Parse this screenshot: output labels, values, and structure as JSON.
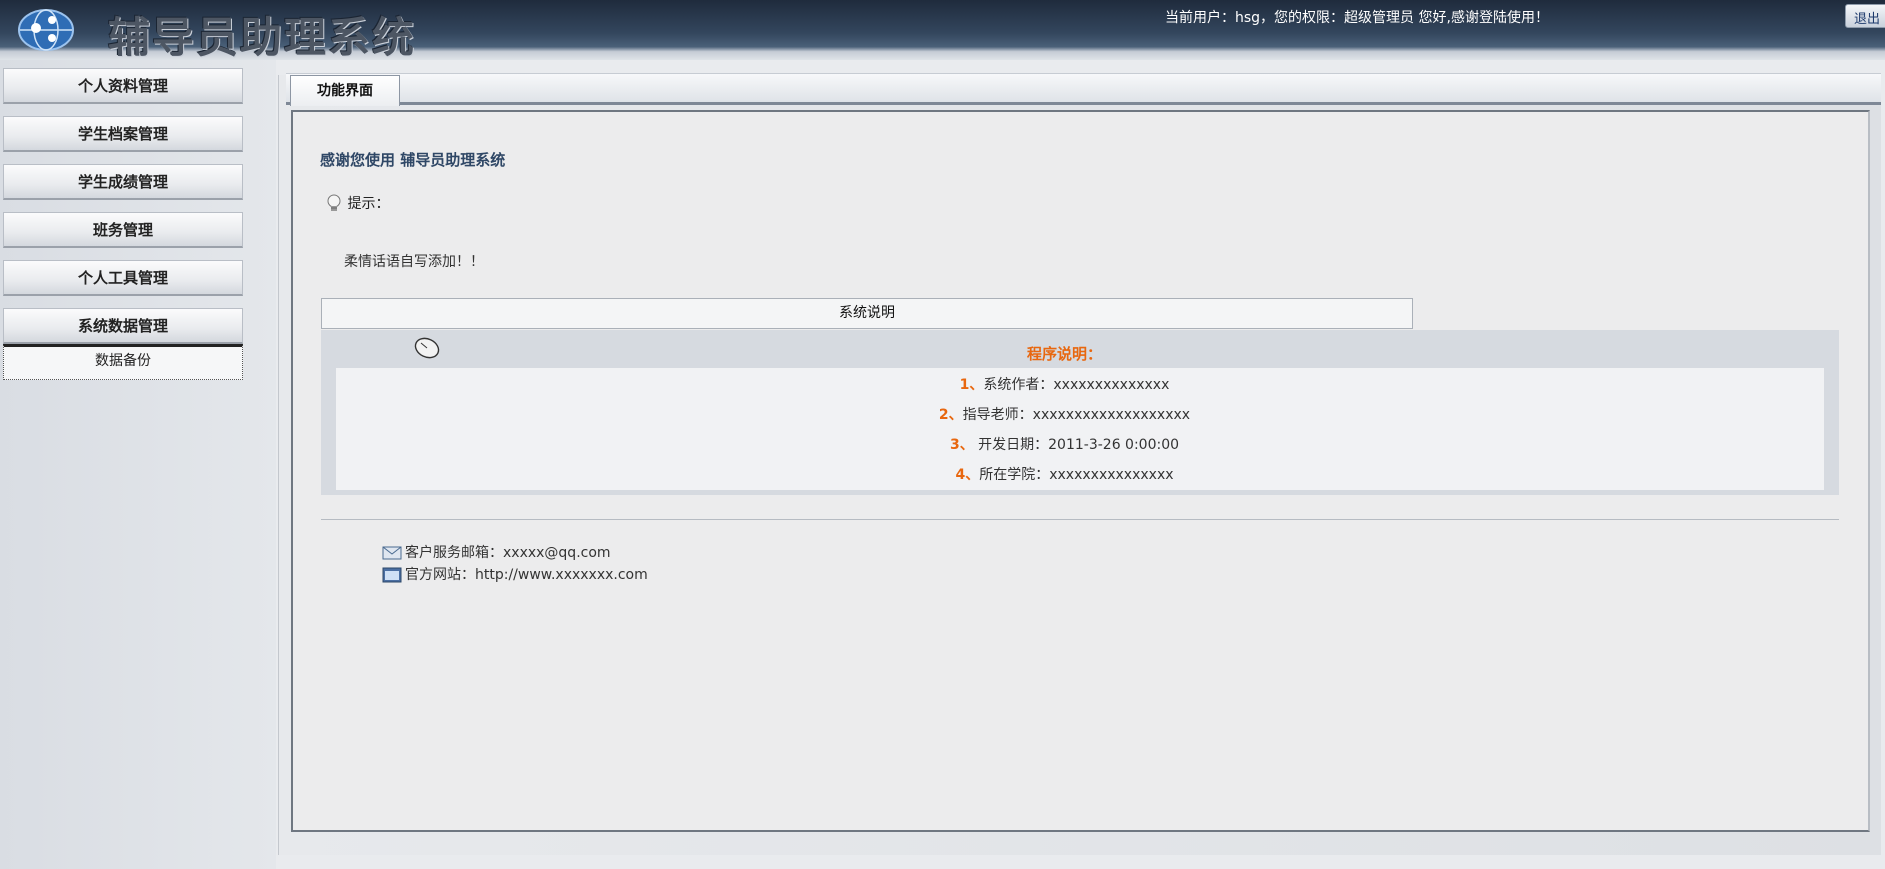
{
  "header": {
    "app_title": "辅导员助理系统",
    "user_info": "当前用户：hsg，您的权限：超级管理员 您好,感谢登陆使用！",
    "logout_label": "退出"
  },
  "sidebar": {
    "items": [
      {
        "label": "个人资料管理"
      },
      {
        "label": "学生档案管理"
      },
      {
        "label": "学生成绩管理"
      },
      {
        "label": "班务管理"
      },
      {
        "label": "个人工具管理"
      },
      {
        "label": "系统数据管理"
      }
    ],
    "submenu_item": "数据备份"
  },
  "main": {
    "tab_label": "功能界面",
    "welcome": "感谢您使用 辅导员助理系统",
    "tip_label": "提示：",
    "message": "柔情话语自写添加！！",
    "system_desc_label": "系统说明",
    "program_title": "程序说明：",
    "info_lines": [
      {
        "num": "1、",
        "text": "系统作者：xxxxxxxxxxxxxx"
      },
      {
        "num": "2、",
        "text": "指导老师：xxxxxxxxxxxxxxxxxxx"
      },
      {
        "num": "3、",
        "text": "  开发日期：2011-3-26 0:00:00"
      },
      {
        "num": "4、",
        "text": "所在学院：xxxxxxxxxxxxxxx"
      }
    ],
    "contact_email": "客户服务邮箱：xxxxx@qq.com",
    "contact_site": "官方网站：http://www.xxxxxxx.com"
  },
  "colors": {
    "header_bg": "#33465d",
    "accent_orange": "#e8670f",
    "welcome_blue": "#2f4766"
  },
  "icons": [
    "globe-logo-icon",
    "lightbulb-icon",
    "mouse-icon",
    "envelope-icon",
    "website-icon"
  ]
}
